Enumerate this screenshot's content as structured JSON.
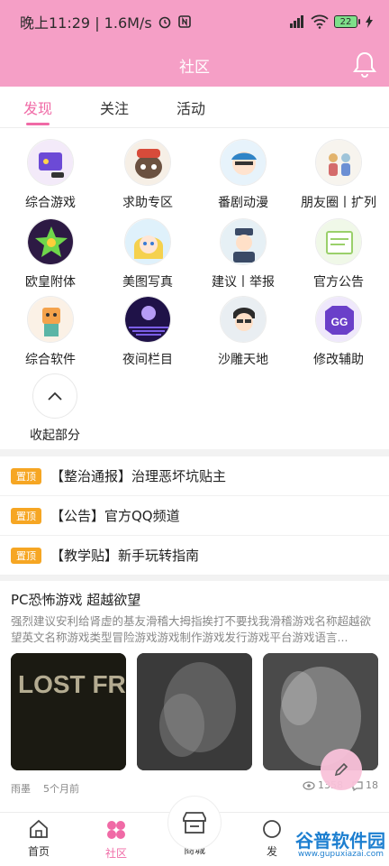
{
  "status_bar": {
    "time": "晚上11:29 | 1.6M/s",
    "battery": "22"
  },
  "header": {
    "title": "社区"
  },
  "tabs": [
    {
      "label": "发现"
    },
    {
      "label": "关注"
    },
    {
      "label": "活动"
    }
  ],
  "categories": [
    {
      "label": "综合游戏"
    },
    {
      "label": "求助专区"
    },
    {
      "label": "番剧动漫"
    },
    {
      "label": "朋友圈丨扩列"
    },
    {
      "label": "欧皇附体"
    },
    {
      "label": "美图写真"
    },
    {
      "label": "建议丨举报"
    },
    {
      "label": "官方公告"
    },
    {
      "label": "综合软件"
    },
    {
      "label": "夜间栏目"
    },
    {
      "label": "沙雕天地"
    },
    {
      "label": "修改辅助"
    }
  ],
  "collapse": {
    "label": "收起部分"
  },
  "pinned": [
    {
      "badge": "置顶",
      "text": "【整治通报】治理恶坏坑贴主"
    },
    {
      "badge": "置顶",
      "text": "【公告】官方QQ频道"
    },
    {
      "badge": "置顶",
      "text": "【教学贴】新手玩转指南"
    }
  ],
  "post": {
    "title": "PC恐怖游戏  超越欲望",
    "summary": "强烈建议安利给肾虚的基友滑稽大拇指挨打不要找我滑稽游戏名称超越欲望英文名称游戏类型冒险游戏游戏制作游戏发行游戏平台游戏语言...",
    "thumb_text": "LOST FROM BEYOND",
    "author": "雨墨",
    "time": "5个月前",
    "views": "1358",
    "comments": "18"
  },
  "bottom_nav": [
    {
      "label": "首页"
    },
    {
      "label": "社区"
    },
    {
      "label": "商城"
    },
    {
      "label": "发"
    }
  ],
  "watermark": {
    "text": "谷普软件园",
    "url": "www.gupuxiazai.com"
  },
  "colors": {
    "accent": "#f06aa6",
    "header": "#f59fc6",
    "pin": "#f6a623"
  }
}
